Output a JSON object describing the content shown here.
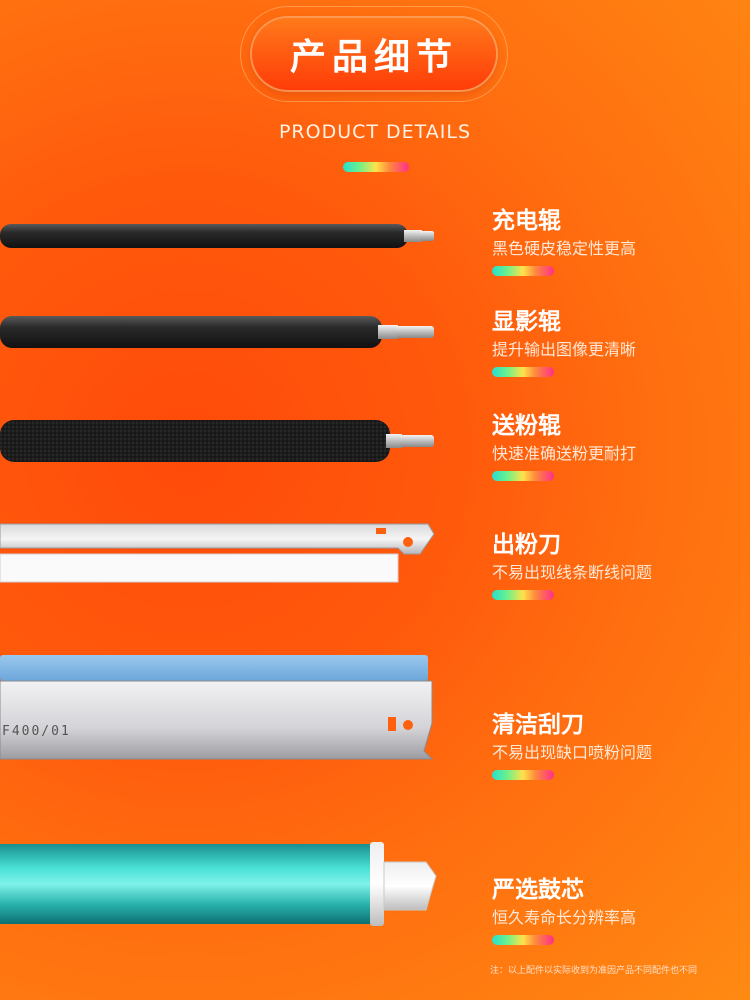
{
  "header": {
    "title": "产品细节",
    "subtitle": "PRODUCT DETAILS"
  },
  "items": [
    {
      "name": "充电辊",
      "desc": "黑色硬皮稳定性更高",
      "icon": "charge-roller"
    },
    {
      "name": "显影辊",
      "desc": "提升输出图像更清晰",
      "icon": "developer-roller"
    },
    {
      "name": "送粉辊",
      "desc": "快速准确送粉更耐打",
      "icon": "toner-feed-roller"
    },
    {
      "name": "出粉刀",
      "desc": "不易出现线条断线问题",
      "icon": "doctor-blade"
    },
    {
      "name": "清洁刮刀",
      "desc": "不易出现缺口喷粉问题",
      "icon": "cleaning-blade",
      "part_marking": "F400/01"
    },
    {
      "name": "严选鼓芯",
      "desc": "恒久寿命长分辨率高",
      "icon": "opc-drum"
    }
  ],
  "footer": {
    "note": "注：以上配件以实际收到为准因产品不同配件也不同"
  }
}
